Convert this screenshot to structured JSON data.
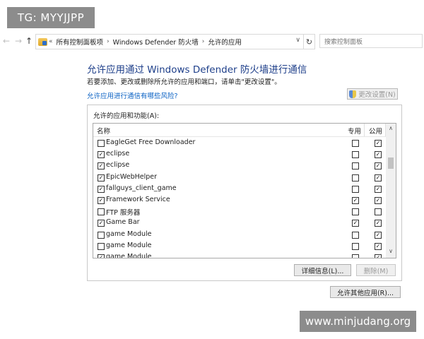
{
  "watermarks": {
    "top_left": "TG: MYYJJPP",
    "bottom_right": "www.minjudang.org"
  },
  "address_bar": {
    "back_icon": "←",
    "forward_icon": "→",
    "up_icon": "↑",
    "overflow": "«",
    "crumbs": [
      "所有控制面板项",
      "Windows Defender 防火墙",
      "允许的应用"
    ],
    "separator": "›",
    "dropdown_icon": "∨",
    "refresh_icon": "↻",
    "search_placeholder": "搜索控制面板"
  },
  "main": {
    "title": "允许应用通过 Windows Defender 防火墙进行通信",
    "instructions": "若要添加、更改或删除所允许的应用和端口，请单击\"更改设置\"。",
    "risk_link": "允许应用进行通信有哪些风险?",
    "change_settings_label": "更改设置(N)"
  },
  "apps_panel": {
    "label": "允许的应用和功能(A):",
    "columns": {
      "name": "名称",
      "private": "专用",
      "public": "公用"
    },
    "rows": [
      {
        "name": "EagleGet Free Downloader",
        "enabled": false,
        "private": false,
        "public": true
      },
      {
        "name": "eclipse",
        "enabled": true,
        "private": false,
        "public": true
      },
      {
        "name": "eclipse",
        "enabled": true,
        "private": false,
        "public": true
      },
      {
        "name": "EpicWebHelper",
        "enabled": true,
        "private": false,
        "public": true
      },
      {
        "name": "fallguys_client_game",
        "enabled": true,
        "private": false,
        "public": true
      },
      {
        "name": "Framework Service",
        "enabled": true,
        "private": true,
        "public": true
      },
      {
        "name": "FTP 服务器",
        "enabled": false,
        "private": false,
        "public": false
      },
      {
        "name": "Game Bar",
        "enabled": true,
        "private": true,
        "public": true
      },
      {
        "name": "game Module",
        "enabled": false,
        "private": false,
        "public": true
      },
      {
        "name": "game Module",
        "enabled": false,
        "private": false,
        "public": true
      },
      {
        "name": "game Module",
        "enabled": true,
        "private": false,
        "public": true
      }
    ],
    "scroll_up_icon": "∧",
    "scroll_down_icon": "∨",
    "details_label": "详细信息(L)...",
    "remove_label": "删除(M)"
  },
  "allow_other_label": "允许其他应用(R)...",
  "check_glyph": "✓"
}
